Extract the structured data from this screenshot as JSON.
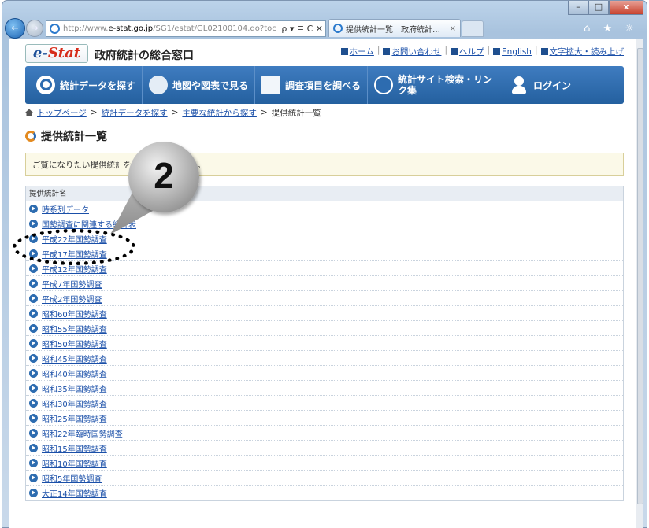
{
  "browser": {
    "url_prefix": "http://www.",
    "url_host": "e-stat.go.jp",
    "url_path": "/SG1/estat/GL02100104.do?toc",
    "address_controls": "ρ ▾ ≣ C ✕",
    "tab_title": "提供統計一覧　政府統計…",
    "tab_close": "×",
    "win_min": "–",
    "win_max": "□",
    "win_close": "x",
    "toolbar_icons": "⌂ ★ ☼"
  },
  "header": {
    "logo_e": "e-",
    "logo_stat": "Stat",
    "site_name": "政府統計の総合窓口",
    "links": [
      "ホーム",
      "お問い合わせ",
      "ヘルプ",
      "English",
      "文字拡大・読み上げ"
    ]
  },
  "gnav": {
    "items": [
      "統計データを探す",
      "地図や図表で見る",
      "調査項目を調べる",
      "統計サイト検索・リンク集",
      "ログイン"
    ]
  },
  "breadcrumb": {
    "items": [
      "トップページ",
      "統計データを探す",
      "主要な統計から探す"
    ],
    "current": "提供統計一覧",
    "sep": ">"
  },
  "page": {
    "title": "提供統計一覧",
    "notice": "ご覧になりたい提供統計を選択してください。"
  },
  "list": {
    "header": "提供統計名",
    "rows": [
      "時系列データ",
      "国勢調査に関連する統計表",
      "平成22年国勢調査",
      "平成17年国勢調査",
      "平成12年国勢調査",
      "平成7年国勢調査",
      "平成2年国勢調査",
      "昭和60年国勢調査",
      "昭和55年国勢調査",
      "昭和50年国勢調査",
      "昭和45年国勢調査",
      "昭和40年国勢調査",
      "昭和35年国勢調査",
      "昭和30年国勢調査",
      "昭和25年国勢調査",
      "昭和22年臨時国勢調査",
      "昭和15年国勢調査",
      "昭和10年国勢調査",
      "昭和5年国勢調査",
      "大正14年国勢調査"
    ]
  },
  "annotation": {
    "step_number": "2"
  }
}
